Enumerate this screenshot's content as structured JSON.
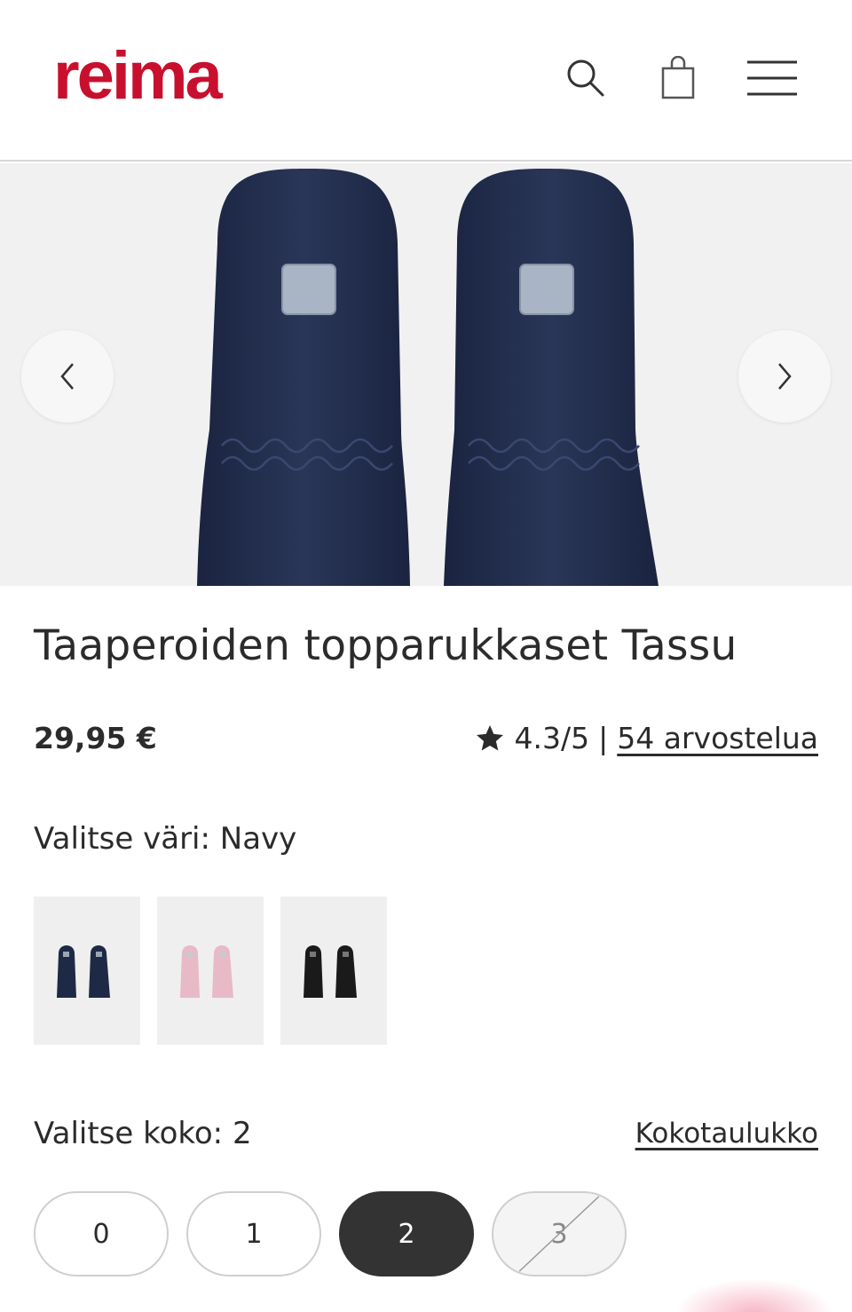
{
  "header": {
    "logo_text": "reima",
    "brand_color": "#c8102e",
    "icons": [
      "search-icon",
      "shopping-bag-icon",
      "menu-icon"
    ]
  },
  "hero": {
    "prev_icon": "chevron-left-icon",
    "next_icon": "chevron-right-icon",
    "product_color": "#1e2a45"
  },
  "product": {
    "title": "Taaperoiden topparukkaset Tassu",
    "price": "29,95 €",
    "rating": "4.3/5",
    "rating_separator": "|",
    "reviews_link": "54 arvostelua"
  },
  "color": {
    "label": "Valitse väri: Navy",
    "swatches": [
      {
        "name": "Navy",
        "hex": "#1e2a45"
      },
      {
        "name": "Pink",
        "hex": "#e8b9c6"
      },
      {
        "name": "Black",
        "hex": "#1a1a1a"
      }
    ]
  },
  "size": {
    "label": "Valitse koko: 2",
    "chart_link": "Kokotaulukko",
    "options": [
      {
        "label": "0",
        "state": "available"
      },
      {
        "label": "1",
        "state": "available"
      },
      {
        "label": "2",
        "state": "selected"
      },
      {
        "label": "3",
        "state": "unavailable"
      }
    ]
  }
}
